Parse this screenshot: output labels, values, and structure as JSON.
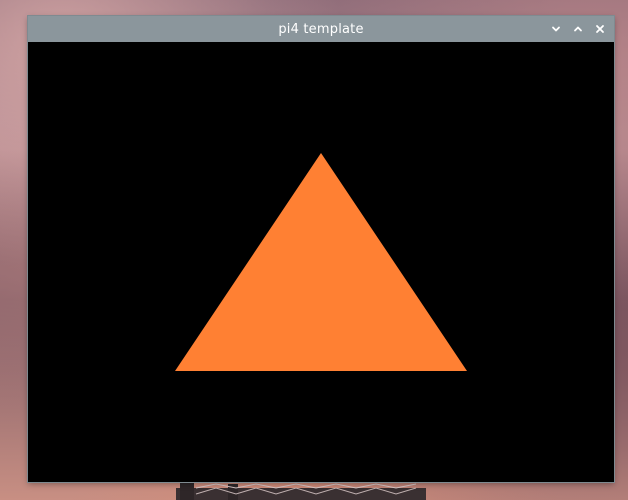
{
  "desktop": {
    "wallpaper": "sunset-bridge"
  },
  "window": {
    "title": "pi4 template",
    "controls": {
      "minimize_icon": "chevron-down-icon",
      "maximize_icon": "chevron-up-icon",
      "close_icon": "close-icon"
    },
    "titlebar_color": "#8b969c",
    "content": {
      "background": "#000000",
      "shape": "triangle",
      "shape_color": "#ff8033"
    }
  }
}
